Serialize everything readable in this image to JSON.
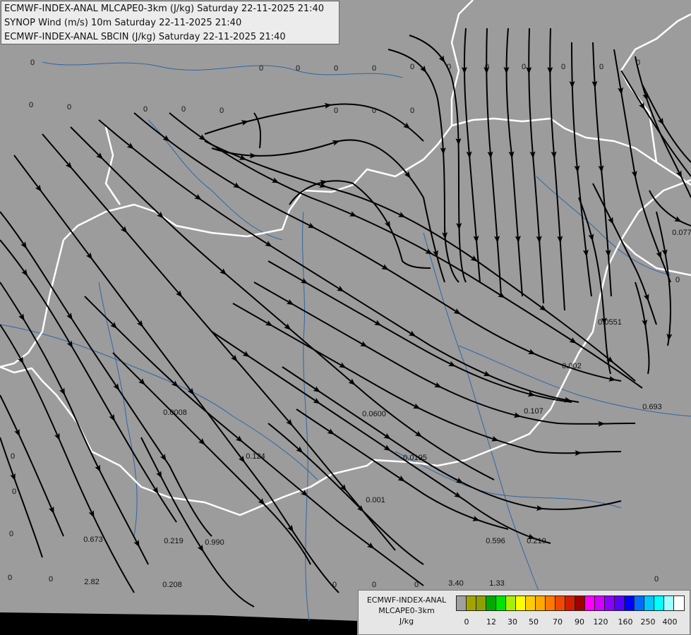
{
  "header": {
    "line1": "ECMWF-INDEX-ANAL MLCAPE0-3km (J/kg) Saturday 22-11-2025 21:40",
    "line2": "SYNOP Wind (m/s) 10m Saturday 22-11-2025 21:40",
    "line3": "ECMWF-INDEX-ANAL SBCIN (J/kg) Saturday 22-11-2025 21:40"
  },
  "legend": {
    "line1": "ECMWF-INDEX-ANAL",
    "line2": "MLCAPE0-3km",
    "line3": "J/kg",
    "colors": [
      "#a0a0a0",
      "#a3a300",
      "#8ea000",
      "#00a800",
      "#00e400",
      "#a8f000",
      "#ffff00",
      "#ffcc00",
      "#ffa800",
      "#ff7800",
      "#f04800",
      "#d21e00",
      "#a00000",
      "#ff00ff",
      "#d200ff",
      "#8c00ff",
      "#5a00ff",
      "#0000ff",
      "#006cff",
      "#00c8ff",
      "#00ffff",
      "#a0ffff",
      "#ffffff"
    ],
    "ticks": [
      "0",
      "12",
      "30",
      "50",
      "70",
      "90",
      "120",
      "160",
      "250",
      "400"
    ]
  },
  "values": [
    "0",
    "0",
    "0",
    "0",
    "0",
    "0",
    "0",
    "0",
    "0",
    "0",
    "0",
    "0",
    "0",
    "0",
    "0",
    "0",
    "0",
    "0",
    "0",
    "0",
    "0",
    "0",
    "0",
    "0",
    "0",
    "0",
    "0",
    "0",
    "0",
    "0",
    "0.0008",
    "0.0600",
    "0.107",
    "0.0195",
    "0.001",
    "0.124",
    "0.673",
    "0.219",
    "0.990",
    "0.596",
    "0.219",
    "2.82",
    "0.208",
    "3.40",
    "1.33",
    "0.693",
    "0.002",
    "0.0551",
    "0.077"
  ]
}
